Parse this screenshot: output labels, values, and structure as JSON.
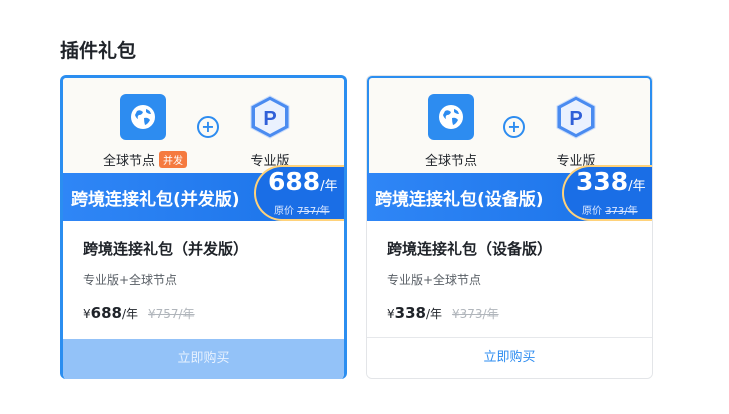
{
  "section_title": "插件礼包",
  "colors": {
    "accent": "#2d8cf0",
    "tag": "#f57a3f",
    "disabled_button": "#93c2f8"
  },
  "cards": [
    {
      "product_a": {
        "label": "全球节点",
        "icon": "globe-icon",
        "tag": "并发"
      },
      "product_b": {
        "label": "专业版",
        "icon": "pro-badge-icon",
        "letter": "P"
      },
      "plus_icon": "plus-circle-icon",
      "banner_name": "跨境连接礼包(并发版)",
      "badge_price": "688",
      "badge_unit": "/年",
      "badge_orig_label": "原价",
      "badge_orig_price": "757/年",
      "name": "跨境连接礼包（并发版）",
      "desc": "专业版+全球节点",
      "price_symbol": "¥",
      "price": "688",
      "price_unit": "/年",
      "old_price": "¥757/年",
      "buy_label": "立即购买",
      "buy_disabled": true
    },
    {
      "product_a": {
        "label": "全球节点",
        "icon": "globe-icon",
        "tag": ""
      },
      "product_b": {
        "label": "专业版",
        "icon": "pro-badge-icon",
        "letter": "P"
      },
      "plus_icon": "plus-circle-icon",
      "banner_name": "跨境连接礼包(设备版)",
      "badge_price": "338",
      "badge_unit": "/年",
      "badge_orig_label": "原价",
      "badge_orig_price": "373/年",
      "name": "跨境连接礼包（设备版）",
      "desc": "专业版+全球节点",
      "price_symbol": "¥",
      "price": "338",
      "price_unit": "/年",
      "old_price": "¥373/年",
      "buy_label": "立即购买",
      "buy_disabled": false
    }
  ]
}
